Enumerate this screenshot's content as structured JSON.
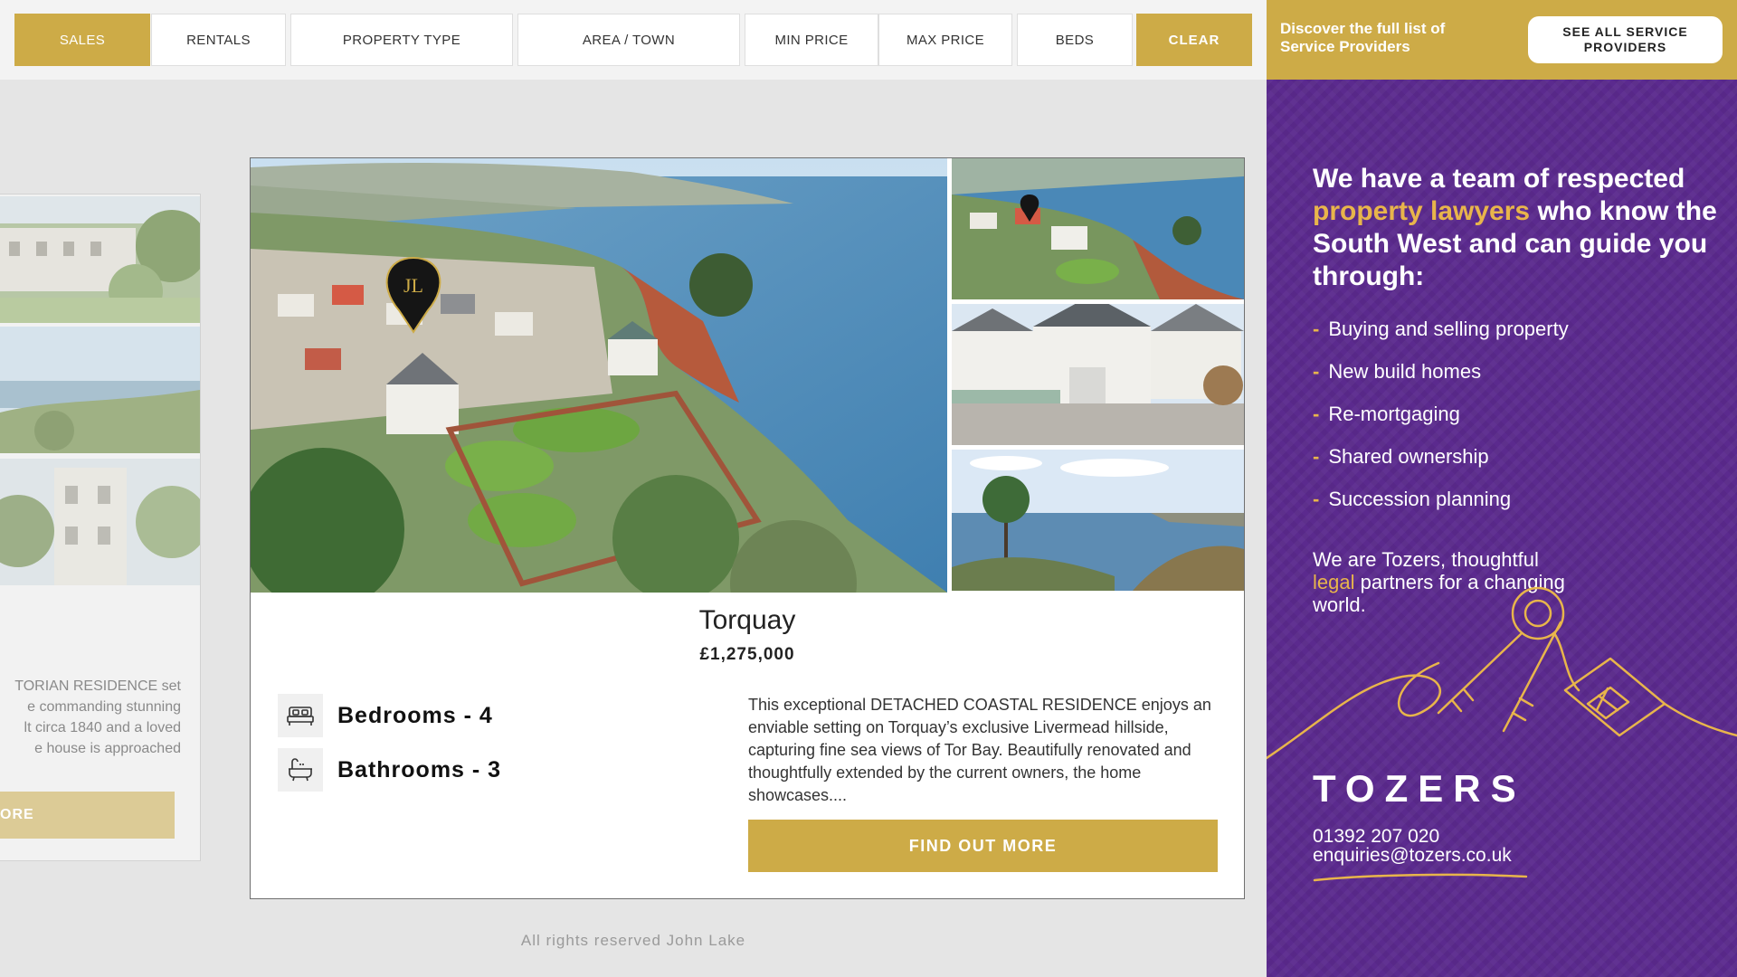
{
  "filters": {
    "sales": "SALES",
    "rentals": "RENTALS",
    "property_type": "PROPERTY TYPE",
    "area_town": "AREA / TOWN",
    "min_price": "MIN PRICE",
    "max_price": "MAX PRICE",
    "beds": "BEDS",
    "clear": "CLEAR"
  },
  "sidebar": {
    "discover_text": "Discover the full list of Service Providers",
    "see_all_button": "SEE ALL SERVICE PROVIDERS",
    "ad": {
      "headline_before": "We have a team of respected ",
      "headline_highlight": "property lawyers",
      "headline_after": " who know the South West and can guide you through:",
      "bullets": [
        "Buying and selling property",
        "New build homes",
        "Re-mortgaging",
        "Shared ownership",
        "Succession planning"
      ],
      "tagline_before": "We are Tozers, thoughtful ",
      "tagline_highlight": "legal",
      "tagline_after": " partners for a changing world.",
      "logo": "TOZERS",
      "phone": "01392 207 020",
      "email": "enquiries@tozers.co.uk"
    }
  },
  "prev_listing": {
    "description_lines": [
      "TORIAN RESIDENCE set",
      "e commanding stunning",
      "lt circa 1840 and a loved",
      "e house is approached"
    ],
    "more_button": "ORE"
  },
  "listing": {
    "title": "Torquay",
    "price": "£1,275,000",
    "bedrooms": "Bedrooms - 4",
    "bathrooms": "Bathrooms - 3",
    "description": "This exceptional DETACHED COASTAL RESIDENCE enjoys an enviable setting on Torquay’s exclusive Livermead hillside, capturing fine sea views of Tor Bay. Beautifully renovated and thoughtfully extended by the current owners, the home showcases....",
    "find_out_more": "FIND OUT MORE",
    "marker_initials": "JL"
  },
  "footer": "All rights reserved John Lake",
  "colors": {
    "gold": "#cdab47",
    "purple": "#5b2a8e",
    "ad_highlight": "#e8b54b"
  }
}
